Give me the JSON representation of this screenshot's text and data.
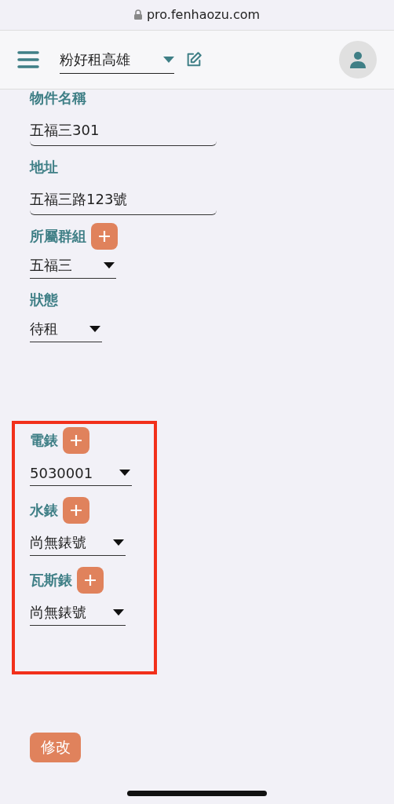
{
  "browser": {
    "url": "pro.fenhaozu.com"
  },
  "header": {
    "account": "粉好租高雄"
  },
  "fields": [
    {
      "kind": "text",
      "label": "物件名稱",
      "value": "五福三301",
      "addable": false
    },
    {
      "kind": "text",
      "label": "地址",
      "value": "五福三路123號",
      "addable": false
    },
    {
      "kind": "select",
      "label": "所屬群組",
      "value": "五福三",
      "addable": true
    },
    {
      "kind": "select",
      "label": "狀態",
      "value": "待租",
      "addable": false
    }
  ],
  "highlighted_fields": [
    {
      "kind": "select",
      "label": "電錶",
      "value": "5030001",
      "addable": true
    },
    {
      "kind": "select",
      "label": "水錶",
      "value": "尚無錶號",
      "addable": true
    },
    {
      "kind": "select",
      "label": "瓦斯錶",
      "value": "尚無錶號",
      "addable": true
    }
  ],
  "submit_button": "修改"
}
